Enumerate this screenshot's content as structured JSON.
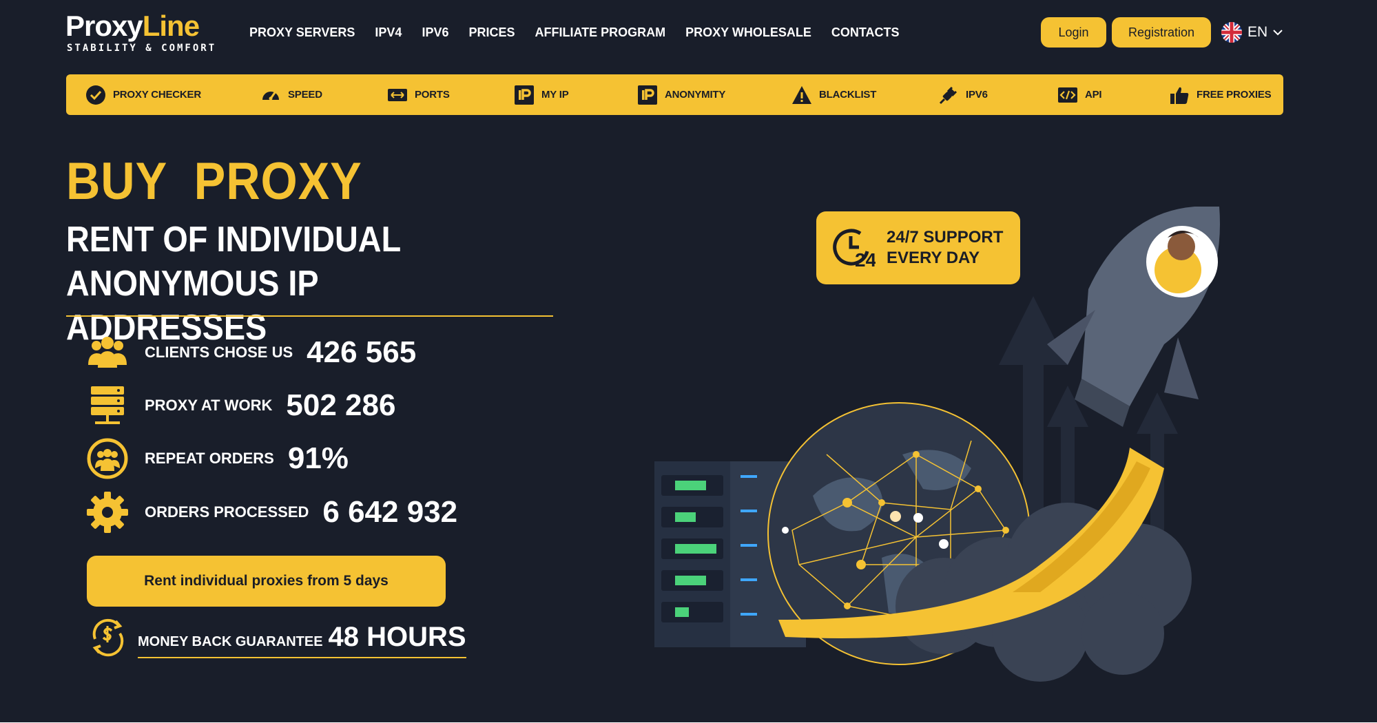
{
  "brand": {
    "name_part1": "Proxy",
    "name_part2": "Line",
    "tagline": "STABILITY & COMFORT"
  },
  "nav": {
    "items": [
      {
        "label": "PROXY SERVERS"
      },
      {
        "label": "IPV4"
      },
      {
        "label": "IPV6"
      },
      {
        "label": "PRICES"
      },
      {
        "label": "AFFILIATE PROGRAM"
      },
      {
        "label": "PROXY WHOLESALE"
      },
      {
        "label": "CONTACTS"
      }
    ]
  },
  "auth": {
    "login_label": "Login",
    "register_label": "Registration"
  },
  "language": {
    "code": "EN",
    "flag_icon": "uk-flag-icon"
  },
  "toolbar": {
    "items": [
      {
        "label": "PROXY CHECKER",
        "icon": "check-circle-icon"
      },
      {
        "label": "SPEED",
        "icon": "speedometer-icon"
      },
      {
        "label": "PORTS",
        "icon": "ports-arrows-icon"
      },
      {
        "label": "MY IP",
        "icon": "ip-badge-icon"
      },
      {
        "label": "ANONYMITY",
        "icon": "ip-badge-icon"
      },
      {
        "label": "BLACKLIST",
        "icon": "warning-icon"
      },
      {
        "label": "IPV6",
        "icon": "plug-icon"
      },
      {
        "label": "API",
        "icon": "code-icon"
      },
      {
        "label": "FREE PROXIES",
        "icon": "thumbs-up-icon"
      }
    ]
  },
  "hero": {
    "title": "BUY  PROXY",
    "subtitle_line1": "RENT OF INDIVIDUAL",
    "subtitle_line2": "ANONYMOUS IP ADDRESSES"
  },
  "stats": [
    {
      "label": "CLIENTS CHOSE US",
      "value": "426 565",
      "icon": "users-group-icon"
    },
    {
      "label": "PROXY AT WORK",
      "value": "502 286",
      "icon": "server-stack-icon"
    },
    {
      "label": "REPEAT ORDERS",
      "value": "91%",
      "icon": "repeat-users-icon"
    },
    {
      "label": "ORDERS PROCESSED",
      "value": "6 642 932",
      "icon": "gear-icon"
    }
  ],
  "cta": {
    "label": "Rent individual proxies from 5 days"
  },
  "guarantee": {
    "label": "MONEY BACK GUARANTEE",
    "value": "48 HOURS",
    "icon": "dollar-refresh-icon"
  },
  "support": {
    "line1": "24/7 SUPPORT",
    "line2": "EVERY DAY",
    "icon_text": "24",
    "icon": "clock-24-icon"
  },
  "colors": {
    "background": "#191e2a",
    "accent": "#f5c233",
    "text_dark": "#1a1d26"
  }
}
